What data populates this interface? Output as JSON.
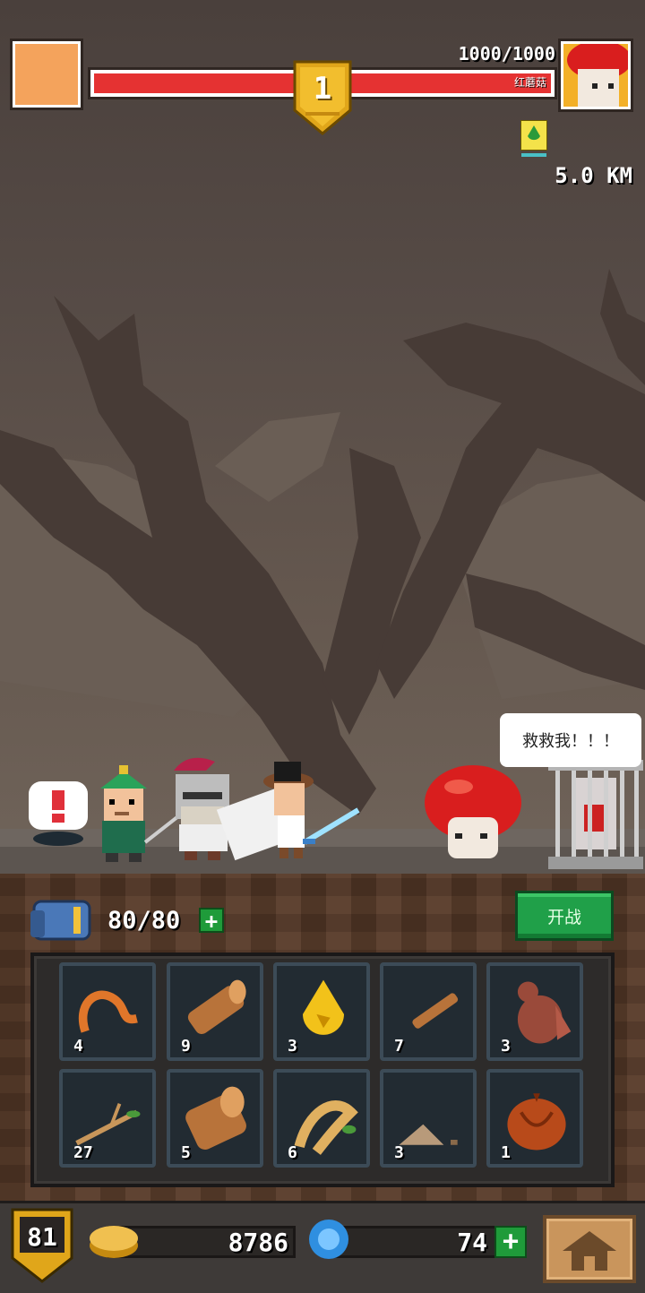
{
  "hud": {
    "stage": "1",
    "hp_text": "1000/1000",
    "hp_fraction": 1.0,
    "enemy_name": "红蘑菇",
    "distance": "5.0 KM"
  },
  "scene": {
    "prisoner_speech": "救救我！！！"
  },
  "inventory": {
    "bag_count": "80/80",
    "battle_button": "开战",
    "plus_symbol": "+",
    "items": [
      {
        "icon": "worm-icon",
        "count": "4"
      },
      {
        "icon": "log-icon",
        "count": "9"
      },
      {
        "icon": "amber-drop-icon",
        "count": "3"
      },
      {
        "icon": "stick-icon",
        "count": "7"
      },
      {
        "icon": "squirrel-icon",
        "count": "3"
      },
      {
        "icon": "twig-icon",
        "count": "27"
      },
      {
        "icon": "stump-icon",
        "count": "5"
      },
      {
        "icon": "ginseng-root-icon",
        "count": "6"
      },
      {
        "icon": "dirt-pile-icon",
        "count": "3"
      },
      {
        "icon": "chestnut-icon",
        "count": "1"
      }
    ]
  },
  "footer": {
    "level": "81",
    "gold": "8786",
    "gems": "74"
  },
  "colors": {
    "hp_red": "#e53232",
    "battle_green": "#20a049",
    "gold": "#f0c050",
    "gem_blue": "#2f8fe0"
  }
}
